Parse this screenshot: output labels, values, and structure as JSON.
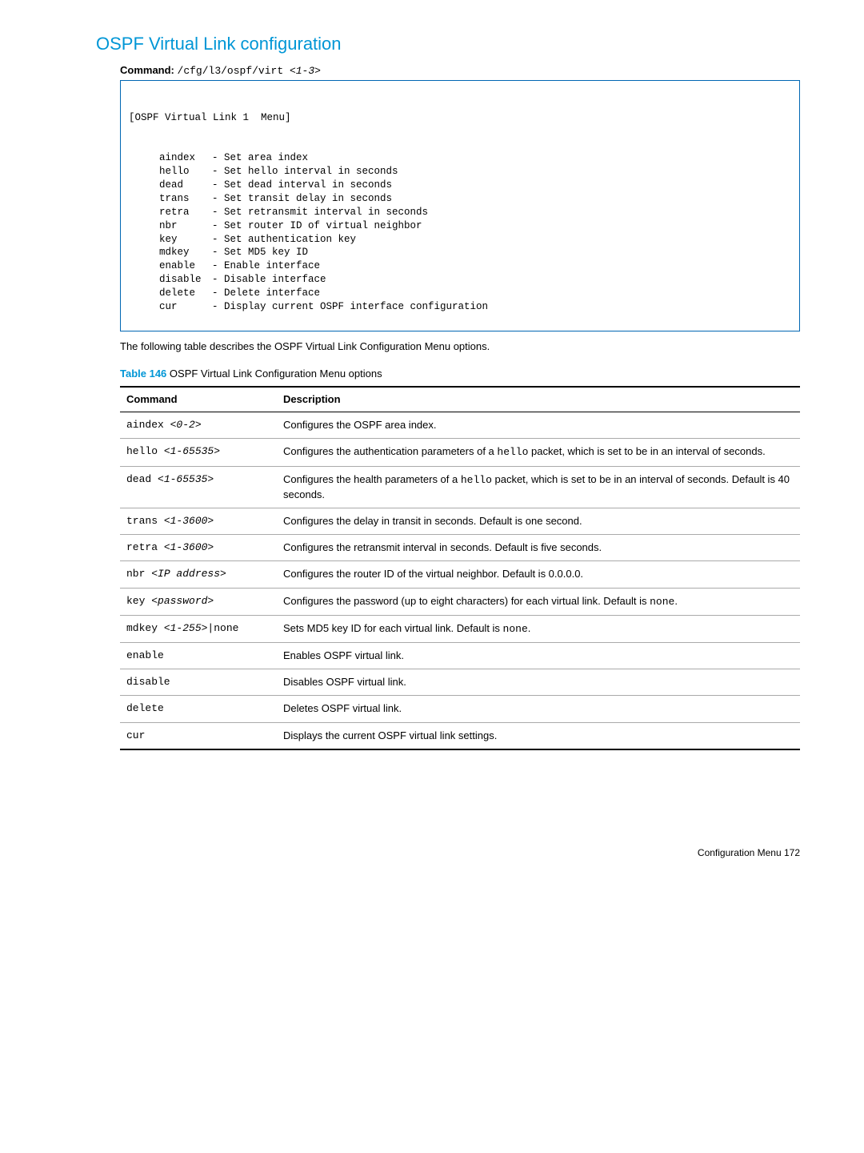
{
  "heading": "OSPF Virtual Link configuration",
  "command": {
    "label": "Command:",
    "path": "/cfg/l3/ospf/virt ",
    "param": "<1-3>"
  },
  "terminal": {
    "header": "[OSPF Virtual Link 1  Menu]",
    "lines": [
      {
        "cmd": "aindex",
        "desc": "- Set area index"
      },
      {
        "cmd": "hello",
        "desc": "- Set hello interval in seconds"
      },
      {
        "cmd": "dead",
        "desc": "- Set dead interval in seconds"
      },
      {
        "cmd": "trans",
        "desc": "- Set transit delay in seconds"
      },
      {
        "cmd": "retra",
        "desc": "- Set retransmit interval in seconds"
      },
      {
        "cmd": "nbr",
        "desc": "- Set router ID of virtual neighbor"
      },
      {
        "cmd": "key",
        "desc": "- Set authentication key"
      },
      {
        "cmd": "mdkey",
        "desc": "- Set MD5 key ID"
      },
      {
        "cmd": "enable",
        "desc": "- Enable interface"
      },
      {
        "cmd": "disable",
        "desc": "- Disable interface"
      },
      {
        "cmd": "delete",
        "desc": "- Delete interface"
      },
      {
        "cmd": "cur",
        "desc": "- Display current OSPF interface configuration"
      }
    ]
  },
  "intro": "The following table describes the OSPF Virtual Link Configuration Menu options.",
  "table_caption": {
    "num": "Table 146",
    "text": "  OSPF Virtual Link Configuration Menu options"
  },
  "table": {
    "headers": {
      "command": "Command",
      "description": "Description"
    },
    "rows": [
      {
        "cmd_pre": "aindex ",
        "cmd_ital": "<0-2>",
        "desc_pre": "Configures the OSPF area index.",
        "desc_mono": "",
        "desc_post": ""
      },
      {
        "cmd_pre": "hello ",
        "cmd_ital": "<1-65535>",
        "desc_pre": "Configures the authentication parameters of a ",
        "desc_mono": "hello",
        "desc_post": " packet, which is set to be in an interval of seconds."
      },
      {
        "cmd_pre": "dead ",
        "cmd_ital": "<1-65535>",
        "desc_pre": "Configures the health parameters of a ",
        "desc_mono": "hello",
        "desc_post": " packet, which is set to be in an interval of seconds. Default is 40 seconds."
      },
      {
        "cmd_pre": "trans ",
        "cmd_ital": "<1-3600>",
        "desc_pre": "Configures the delay in transit in seconds. Default is one second.",
        "desc_mono": "",
        "desc_post": ""
      },
      {
        "cmd_pre": "retra ",
        "cmd_ital": "<1-3600>",
        "desc_pre": "Configures the retransmit interval in seconds. Default is five seconds.",
        "desc_mono": "",
        "desc_post": ""
      },
      {
        "cmd_pre": "nbr ",
        "cmd_ital": "<IP address>",
        "desc_pre": "Configures the router ID of the virtual neighbor. Default is 0.0.0.0.",
        "desc_mono": "",
        "desc_post": ""
      },
      {
        "cmd_pre": "key ",
        "cmd_ital": "<password>",
        "desc_pre": "Configures the password (up to eight characters) for each virtual link. Default is ",
        "desc_mono": "none",
        "desc_post": "."
      },
      {
        "cmd_pre": "mdkey ",
        "cmd_ital": "<1-255>",
        "cmd_post": "|none",
        "desc_pre": "Sets MD5 key ID for each virtual link. Default is ",
        "desc_mono": "none",
        "desc_post": "."
      },
      {
        "cmd_pre": "enable",
        "cmd_ital": "",
        "desc_pre": "Enables OSPF virtual link.",
        "desc_mono": "",
        "desc_post": ""
      },
      {
        "cmd_pre": "disable",
        "cmd_ital": "",
        "desc_pre": "Disables OSPF virtual link.",
        "desc_mono": "",
        "desc_post": ""
      },
      {
        "cmd_pre": "delete",
        "cmd_ital": "",
        "desc_pre": "Deletes OSPF virtual link.",
        "desc_mono": "",
        "desc_post": ""
      },
      {
        "cmd_pre": "cur",
        "cmd_ital": "",
        "desc_pre": "Displays the current OSPF virtual link settings.",
        "desc_mono": "",
        "desc_post": ""
      }
    ]
  },
  "footer": "Configuration Menu   172"
}
